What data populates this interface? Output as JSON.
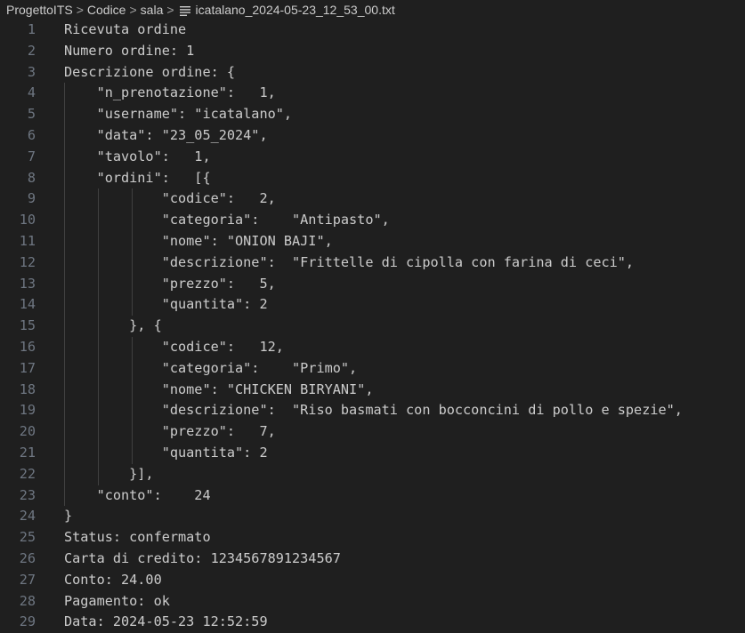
{
  "breadcrumb": {
    "items": [
      "ProgettoITS",
      "Codice",
      "sala"
    ],
    "separator": ">",
    "file_icon": "text-file-icon",
    "file_name": "icatalano_2024-05-23_12_53_00.txt"
  },
  "editor": {
    "lines": [
      {
        "n": "1",
        "text": "Ricevuta ordine",
        "indent": 0
      },
      {
        "n": "2",
        "text": "Numero ordine: 1",
        "indent": 0
      },
      {
        "n": "3",
        "text": "Descrizione ordine: {",
        "indent": 0
      },
      {
        "n": "4",
        "text": "    \"n_prenotazione\":   1,",
        "indent": 1
      },
      {
        "n": "5",
        "text": "    \"username\": \"icatalano\",",
        "indent": 1
      },
      {
        "n": "6",
        "text": "    \"data\": \"23_05_2024\",",
        "indent": 1
      },
      {
        "n": "7",
        "text": "    \"tavolo\":   1,",
        "indent": 1
      },
      {
        "n": "8",
        "text": "    \"ordini\":   [{",
        "indent": 1
      },
      {
        "n": "9",
        "text": "            \"codice\":   2,",
        "indent": 3
      },
      {
        "n": "10",
        "text": "            \"categoria\":    \"Antipasto\",",
        "indent": 3
      },
      {
        "n": "11",
        "text": "            \"nome\": \"ONION BAJI\",",
        "indent": 3
      },
      {
        "n": "12",
        "text": "            \"descrizione\":  \"Frittelle di cipolla con farina di ceci\",",
        "indent": 3
      },
      {
        "n": "13",
        "text": "            \"prezzo\":   5,",
        "indent": 3
      },
      {
        "n": "14",
        "text": "            \"quantita\": 2",
        "indent": 3
      },
      {
        "n": "15",
        "text": "        }, {",
        "indent": 2
      },
      {
        "n": "16",
        "text": "            \"codice\":   12,",
        "indent": 3
      },
      {
        "n": "17",
        "text": "            \"categoria\":    \"Primo\",",
        "indent": 3
      },
      {
        "n": "18",
        "text": "            \"nome\": \"CHICKEN BIRYANI\",",
        "indent": 3
      },
      {
        "n": "19",
        "text": "            \"descrizione\":  \"Riso basmati con bocconcini di pollo e spezie\",",
        "indent": 3
      },
      {
        "n": "20",
        "text": "            \"prezzo\":   7,",
        "indent": 3
      },
      {
        "n": "21",
        "text": "            \"quantita\": 2",
        "indent": 3
      },
      {
        "n": "22",
        "text": "        }],",
        "indent": 2
      },
      {
        "n": "23",
        "text": "    \"conto\":    24",
        "indent": 1
      },
      {
        "n": "24",
        "text": "}",
        "indent": 0
      },
      {
        "n": "25",
        "text": "Status: confermato",
        "indent": 0
      },
      {
        "n": "26",
        "text": "Carta di credito: 1234567891234567",
        "indent": 0
      },
      {
        "n": "27",
        "text": "Conto: 24.00",
        "indent": 0
      },
      {
        "n": "28",
        "text": "Pagamento: ok",
        "indent": 0
      },
      {
        "n": "29",
        "text": "Data: 2024-05-23 12:52:59",
        "indent": 0
      }
    ]
  },
  "colors": {
    "background": "#1f1f1f",
    "text": "#cccccc",
    "line_number": "#6e7681",
    "indent_guide": "#404040"
  }
}
